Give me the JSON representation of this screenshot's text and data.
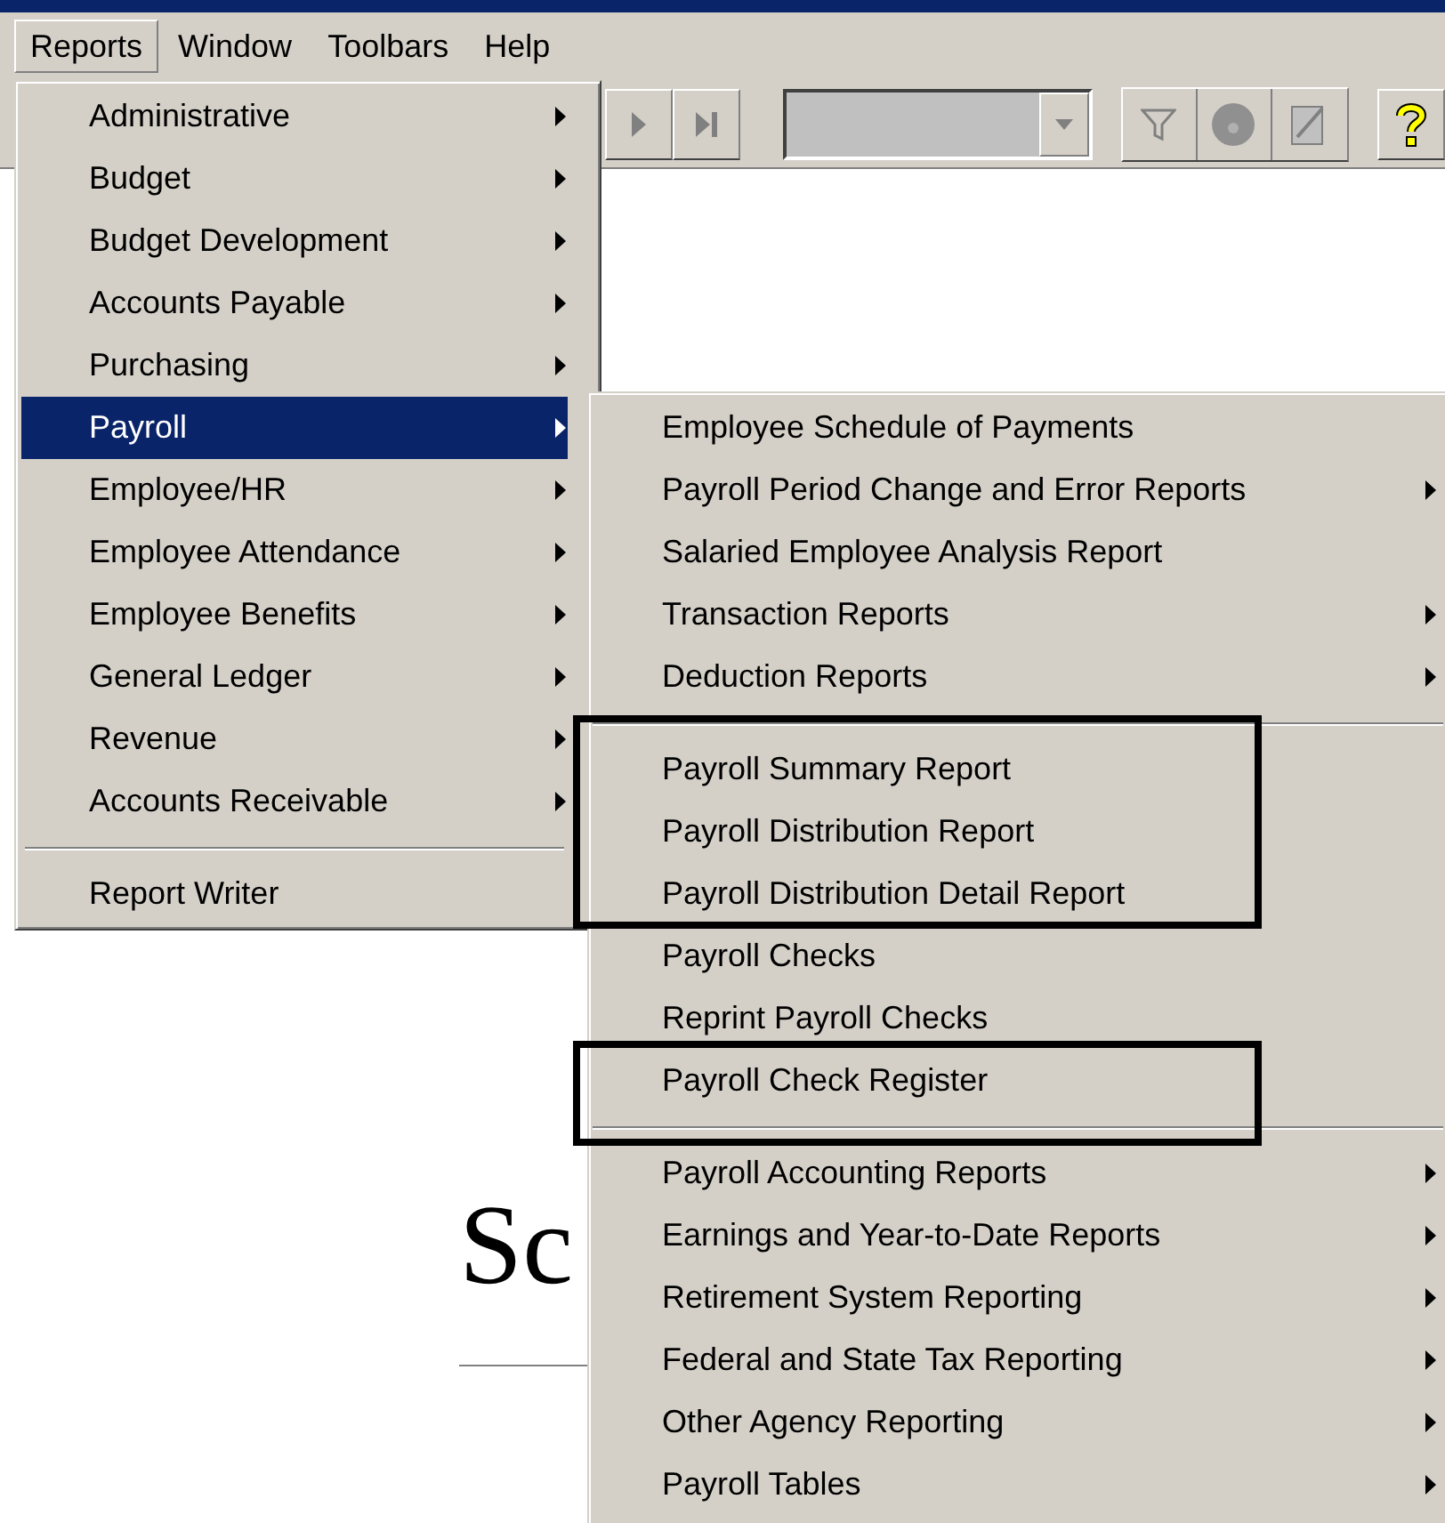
{
  "menubar": [
    {
      "label": "Reports",
      "selected": true
    },
    {
      "label": "Window",
      "selected": false
    },
    {
      "label": "Toolbars",
      "selected": false
    },
    {
      "label": "Help",
      "selected": false
    }
  ],
  "reports_menu": [
    {
      "kind": "item",
      "label": "Administrative",
      "submenu": true,
      "selected": false
    },
    {
      "kind": "item",
      "label": "Budget",
      "submenu": true,
      "selected": false
    },
    {
      "kind": "item",
      "label": "Budget Development",
      "submenu": true,
      "selected": false
    },
    {
      "kind": "item",
      "label": "Accounts Payable",
      "submenu": true,
      "selected": false
    },
    {
      "kind": "item",
      "label": "Purchasing",
      "submenu": true,
      "selected": false
    },
    {
      "kind": "item",
      "label": "Payroll",
      "submenu": true,
      "selected": true
    },
    {
      "kind": "item",
      "label": "Employee/HR",
      "submenu": true,
      "selected": false
    },
    {
      "kind": "item",
      "label": "Employee Attendance",
      "submenu": true,
      "selected": false
    },
    {
      "kind": "item",
      "label": "Employee Benefits",
      "submenu": true,
      "selected": false
    },
    {
      "kind": "item",
      "label": "General Ledger",
      "submenu": true,
      "selected": false
    },
    {
      "kind": "item",
      "label": "Revenue",
      "submenu": true,
      "selected": false
    },
    {
      "kind": "item",
      "label": "Accounts Receivable",
      "submenu": true,
      "selected": false
    },
    {
      "kind": "separator"
    },
    {
      "kind": "item",
      "label": "Report Writer",
      "submenu": false,
      "selected": false
    }
  ],
  "payroll_submenu": [
    {
      "kind": "item",
      "label": "Employee Schedule of Payments",
      "submenu": false,
      "framed": false
    },
    {
      "kind": "item",
      "label": "Payroll Period Change and Error Reports",
      "submenu": true,
      "framed": false
    },
    {
      "kind": "item",
      "label": "Salaried Employee Analysis Report",
      "submenu": false,
      "framed": false
    },
    {
      "kind": "item",
      "label": "Transaction Reports",
      "submenu": true,
      "framed": false
    },
    {
      "kind": "item",
      "label": "Deduction Reports",
      "submenu": true,
      "framed": false
    },
    {
      "kind": "separator"
    },
    {
      "kind": "item",
      "label": "Payroll Summary Report",
      "submenu": false,
      "framed": true
    },
    {
      "kind": "item",
      "label": "Payroll Distribution Report",
      "submenu": false,
      "framed": true
    },
    {
      "kind": "item",
      "label": "Payroll Distribution Detail Report",
      "submenu": false,
      "framed": true
    },
    {
      "kind": "item",
      "label": "Payroll Checks",
      "submenu": false,
      "framed": false
    },
    {
      "kind": "item",
      "label": "Reprint Payroll Checks",
      "submenu": false,
      "framed": false
    },
    {
      "kind": "item",
      "label": "Payroll Check Register",
      "submenu": false,
      "framed": true
    },
    {
      "kind": "separator"
    },
    {
      "kind": "item",
      "label": "Payroll Accounting Reports",
      "submenu": true,
      "framed": false
    },
    {
      "kind": "item",
      "label": "Earnings and Year-to-Date Reports",
      "submenu": true,
      "framed": false
    },
    {
      "kind": "item",
      "label": "Retirement System Reporting",
      "submenu": true,
      "framed": false
    },
    {
      "kind": "item",
      "label": "Federal and State Tax Reporting",
      "submenu": true,
      "framed": false
    },
    {
      "kind": "item",
      "label": "Other Agency Reporting",
      "submenu": true,
      "framed": false
    },
    {
      "kind": "item",
      "label": "Payroll Tables",
      "submenu": true,
      "framed": false
    }
  ],
  "document": {
    "heading": "Sc"
  }
}
